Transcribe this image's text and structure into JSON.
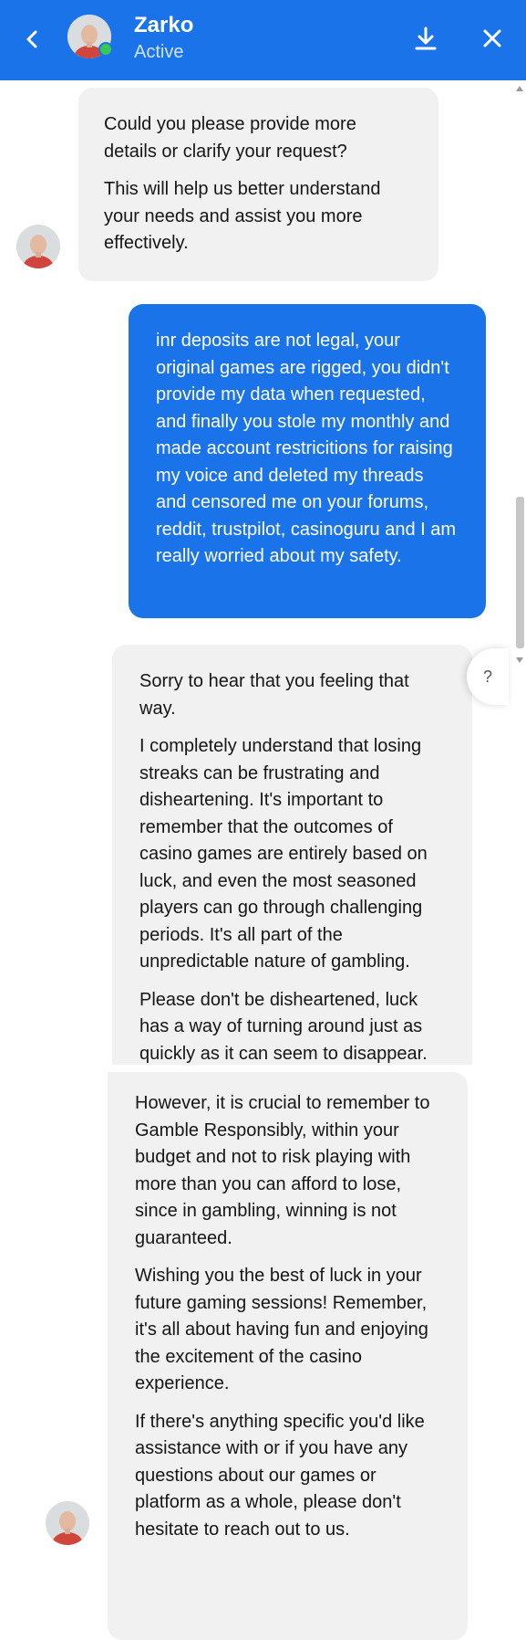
{
  "header": {
    "contact_name": "Zarko",
    "status": "Active",
    "back_icon": "chevron-left-icon",
    "download_icon": "download-icon",
    "close_icon": "close-icon"
  },
  "messages": [
    {
      "sender": "agent",
      "paragraphs": [
        "Could you please provide more details or clarify your request?",
        "This will help us better understand your needs and assist you more effectively."
      ]
    },
    {
      "sender": "user",
      "paragraphs": [
        "inr deposits are not legal, your original games are rigged, you didn't provide my data when requested, and finally you stole my monthly and made account restricitions for raising my voice and deleted my threads and censored me on your forums, reddit, trustpilot, casinoguru and I am really worried about my safety."
      ]
    },
    {
      "sender": "agent",
      "paragraphs": [
        "Sorry to hear that you feeling that way.",
        "I completely understand that losing streaks can be frustrating and disheartening. It's important to remember that the outcomes of casino games are entirely based on luck, and even the most seasoned players can go through challenging periods. It's all part of the unpredictable nature of gambling.",
        "Please don't be disheartened, luck has a way of turning around just as quickly as it can seem to disappear."
      ]
    },
    {
      "sender": "agent",
      "paragraphs": [
        "However, it is crucial to remember to Gamble Responsibly, within your budget and not to risk playing with more than you can afford to lose, since in gambling, winning is not guaranteed.",
        "Wishing you the best of luck in your future gaming sessions! Remember, it's all about having fun and enjoying the excitement of the casino experience.",
        "If there's anything specific you'd like assistance with or if you have any questions about our games or platform as a whole, please don't hesitate to reach out to us."
      ]
    }
  ],
  "help_button": {
    "label": "?"
  },
  "colors": {
    "brand_blue": "#1a73e8",
    "agent_bubble": "#f1f1f1",
    "online": "#34c759"
  }
}
